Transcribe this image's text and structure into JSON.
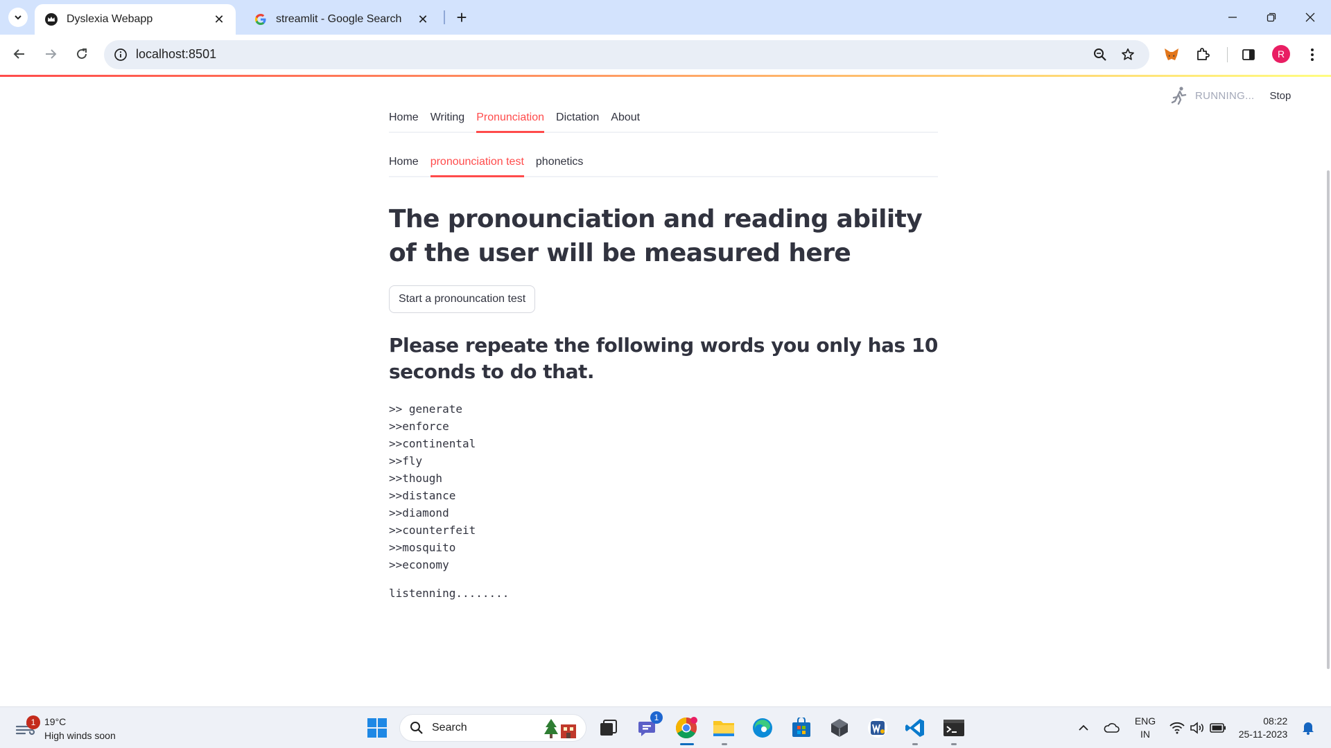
{
  "browser": {
    "tabs": [
      {
        "title": "Dyslexia Webapp",
        "active": true
      },
      {
        "title": "streamlit - Google Search",
        "active": false
      }
    ],
    "url": "localhost:8501",
    "profile_initial": "R"
  },
  "app": {
    "status": {
      "running": "RUNNING...",
      "stop": "Stop"
    },
    "nav_tabs": [
      "Home",
      "Writing",
      "Pronunciation",
      "Dictation",
      "About"
    ],
    "nav_active": "Pronunciation",
    "sub_tabs": [
      "Home",
      "pronounciation test",
      "phonetics"
    ],
    "sub_active": "pronounciation test",
    "heading": "The pronounciation and reading ability of the user will be measured here",
    "start_button": "Start a pronouncation test",
    "subheading": "Please repeate the following words you only has 10 seconds to do that.",
    "words": [
      ">> generate",
      ">>enforce",
      ">>continental",
      ">>fly",
      ">>though",
      ">>distance",
      ">>diamond",
      ">>counterfeit",
      ">>mosquito",
      ">>economy"
    ],
    "listening": "listenning........"
  },
  "taskbar": {
    "weather": {
      "temp": "19°C",
      "desc": "High winds soon",
      "badge": "1"
    },
    "search": "Search",
    "teams_badge": "1",
    "lang": {
      "line1": "ENG",
      "line2": "IN"
    },
    "clock": {
      "time": "08:22",
      "date": "25-11-2023"
    }
  },
  "colors": {
    "accent": "#ff4b4b",
    "text": "#31333f",
    "tabbar": "#d3e3fd"
  }
}
